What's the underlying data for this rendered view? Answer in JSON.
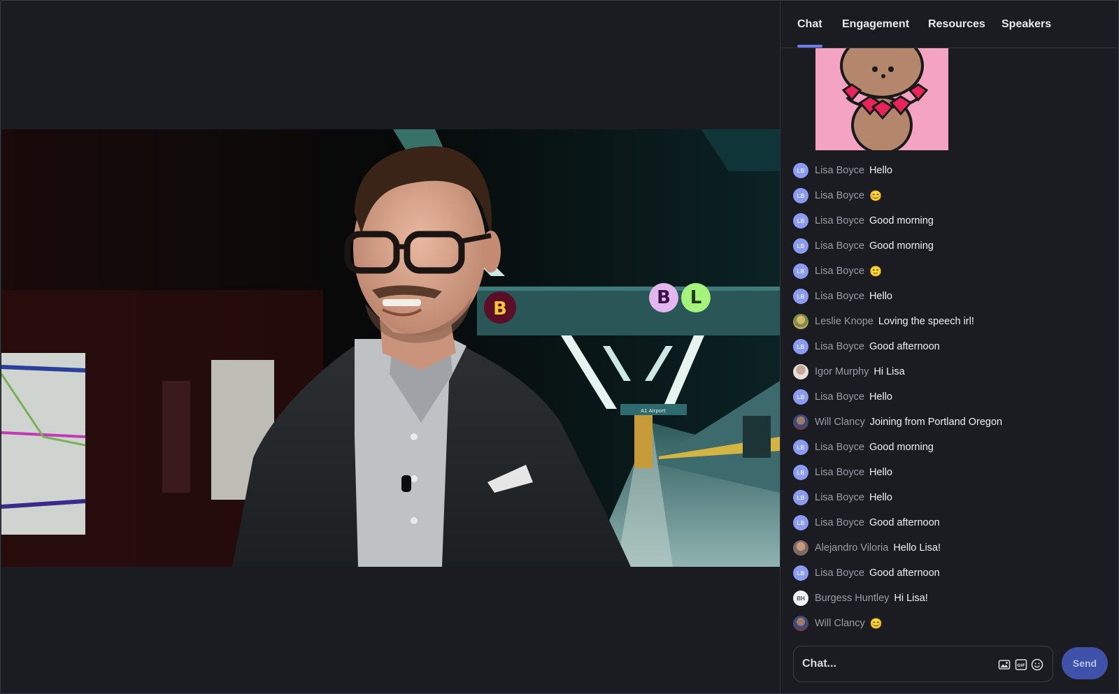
{
  "tabs": [
    {
      "label": "Chat"
    },
    {
      "label": "Engagement"
    },
    {
      "label": "Resources"
    },
    {
      "label": "Speakers"
    }
  ],
  "video": {
    "logo_letters": [
      "B",
      "L"
    ],
    "sign_letter": "B",
    "station_sign": "A1 Airport"
  },
  "chat": {
    "messages": [
      {
        "initials": "LB",
        "sender": "Lisa Boyce",
        "text": "Hello"
      },
      {
        "initials": "LB",
        "sender": "Lisa Boyce",
        "text": "😊"
      },
      {
        "initials": "LB",
        "sender": "Lisa Boyce",
        "text": "Good morning"
      },
      {
        "initials": "LB",
        "sender": "Lisa Boyce",
        "text": "Good morning"
      },
      {
        "initials": "LB",
        "sender": "Lisa Boyce",
        "text": "🙂"
      },
      {
        "initials": "LB",
        "sender": "Lisa Boyce",
        "text": "Hello"
      },
      {
        "initials": "",
        "sender": "Leslie Knope",
        "text": "Loving the speech irl!"
      },
      {
        "initials": "LB",
        "sender": "Lisa Boyce",
        "text": "Good afternoon"
      },
      {
        "initials": "",
        "sender": "Igor Murphy",
        "text": "Hi Lisa"
      },
      {
        "initials": "LB",
        "sender": "Lisa Boyce",
        "text": "Hello"
      },
      {
        "initials": "",
        "sender": "Will Clancy",
        "text": "Joining from Portland Oregon"
      },
      {
        "initials": "LB",
        "sender": "Lisa Boyce",
        "text": "Good morning"
      },
      {
        "initials": "LB",
        "sender": "Lisa Boyce",
        "text": "Hello"
      },
      {
        "initials": "LB",
        "sender": "Lisa Boyce",
        "text": "Hello"
      },
      {
        "initials": "LB",
        "sender": "Lisa Boyce",
        "text": "Good afternoon"
      },
      {
        "initials": "",
        "sender": "Alejandro Viloria",
        "text": "Hello Lisa!"
      },
      {
        "initials": "LB",
        "sender": "Lisa Boyce",
        "text": "Good afternoon"
      },
      {
        "initials": "BH",
        "sender": "Burgess Huntley",
        "text": "Hi Lisa!"
      },
      {
        "initials": "",
        "sender": "Will Clancy",
        "text": "😊"
      }
    ],
    "input_placeholder": "Chat...",
    "send_label": "Send"
  },
  "colors": {
    "accent": "#6d7ce8",
    "send_button": "#3f51a8",
    "initials_avatar": "#8b9bf0"
  },
  "icons": [
    "image-icon",
    "gif-icon",
    "emoji-icon"
  ]
}
